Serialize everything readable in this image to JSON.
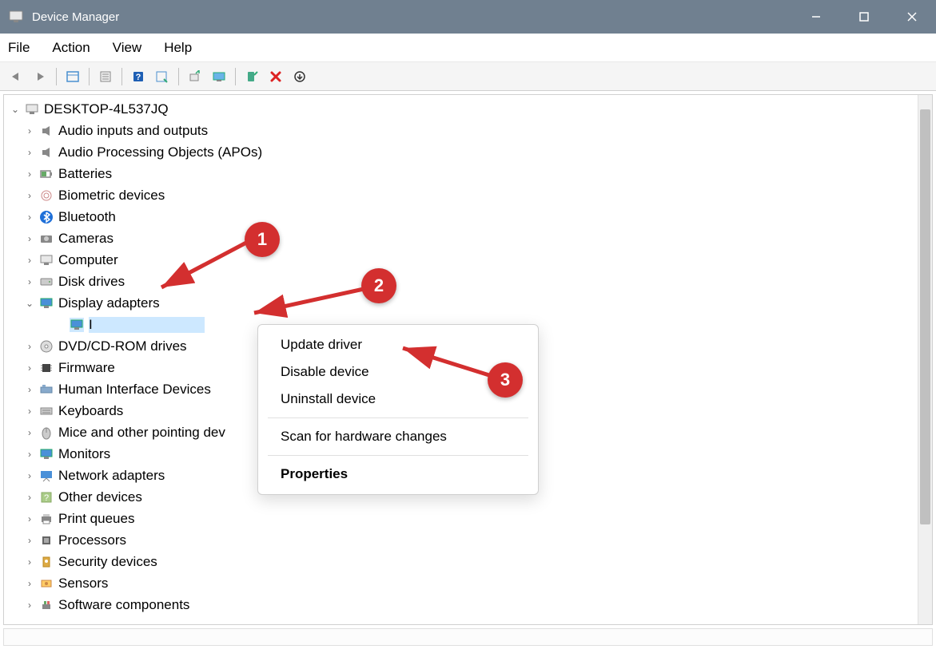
{
  "window": {
    "title": "Device Manager"
  },
  "menu": {
    "items": [
      "File",
      "Action",
      "View",
      "Help"
    ]
  },
  "toolbar": {
    "buttons": [
      "back",
      "forward",
      "sep",
      "show-hidden",
      "sep",
      "properties",
      "sep",
      "help",
      "update",
      "sep",
      "scan",
      "monitor",
      "sep",
      "enable",
      "disable",
      "uninstall-updates"
    ]
  },
  "tree": {
    "root": {
      "label": "DESKTOP-4L537JQ",
      "expanded": true
    },
    "items": [
      {
        "label": "Audio inputs and outputs",
        "icon": "speaker"
      },
      {
        "label": "Audio Processing Objects (APOs)",
        "icon": "speaker"
      },
      {
        "label": "Batteries",
        "icon": "battery"
      },
      {
        "label": "Biometric devices",
        "icon": "fingerprint"
      },
      {
        "label": "Bluetooth",
        "icon": "bluetooth"
      },
      {
        "label": "Cameras",
        "icon": "camera"
      },
      {
        "label": "Computer",
        "icon": "monitor"
      },
      {
        "label": "Disk drives",
        "icon": "disk"
      },
      {
        "label": "Display adapters",
        "icon": "monitor-blue",
        "expanded": true
      },
      {
        "label": "DVD/CD-ROM drives",
        "icon": "disc"
      },
      {
        "label": "Firmware",
        "icon": "chip"
      },
      {
        "label": "Human Interface Devices",
        "icon": "hid"
      },
      {
        "label": "Keyboards",
        "icon": "keyboard"
      },
      {
        "label": "Mice and other pointing devices",
        "icon": "mouse",
        "truncated": "Mice and other pointing dev"
      },
      {
        "label": "Monitors",
        "icon": "monitor-blue"
      },
      {
        "label": "Network adapters",
        "icon": "network"
      },
      {
        "label": "Other devices",
        "icon": "unknown"
      },
      {
        "label": "Print queues",
        "icon": "printer"
      },
      {
        "label": "Processors",
        "icon": "cpu"
      },
      {
        "label": "Security devices",
        "icon": "security"
      },
      {
        "label": "Sensors",
        "icon": "sensor"
      },
      {
        "label": "Software components",
        "icon": "component"
      }
    ],
    "child": {
      "label": "I",
      "icon": "monitor-blue",
      "selected": true
    }
  },
  "context_menu": {
    "items": [
      {
        "label": "Update driver",
        "type": "item"
      },
      {
        "label": "Disable device",
        "type": "item"
      },
      {
        "label": "Uninstall device",
        "type": "item"
      },
      {
        "type": "sep"
      },
      {
        "label": "Scan for hardware changes",
        "type": "item"
      },
      {
        "type": "sep"
      },
      {
        "label": "Properties",
        "type": "item",
        "bold": true
      }
    ]
  },
  "annotations": {
    "badge1": "1",
    "badge2": "2",
    "badge3": "3"
  }
}
